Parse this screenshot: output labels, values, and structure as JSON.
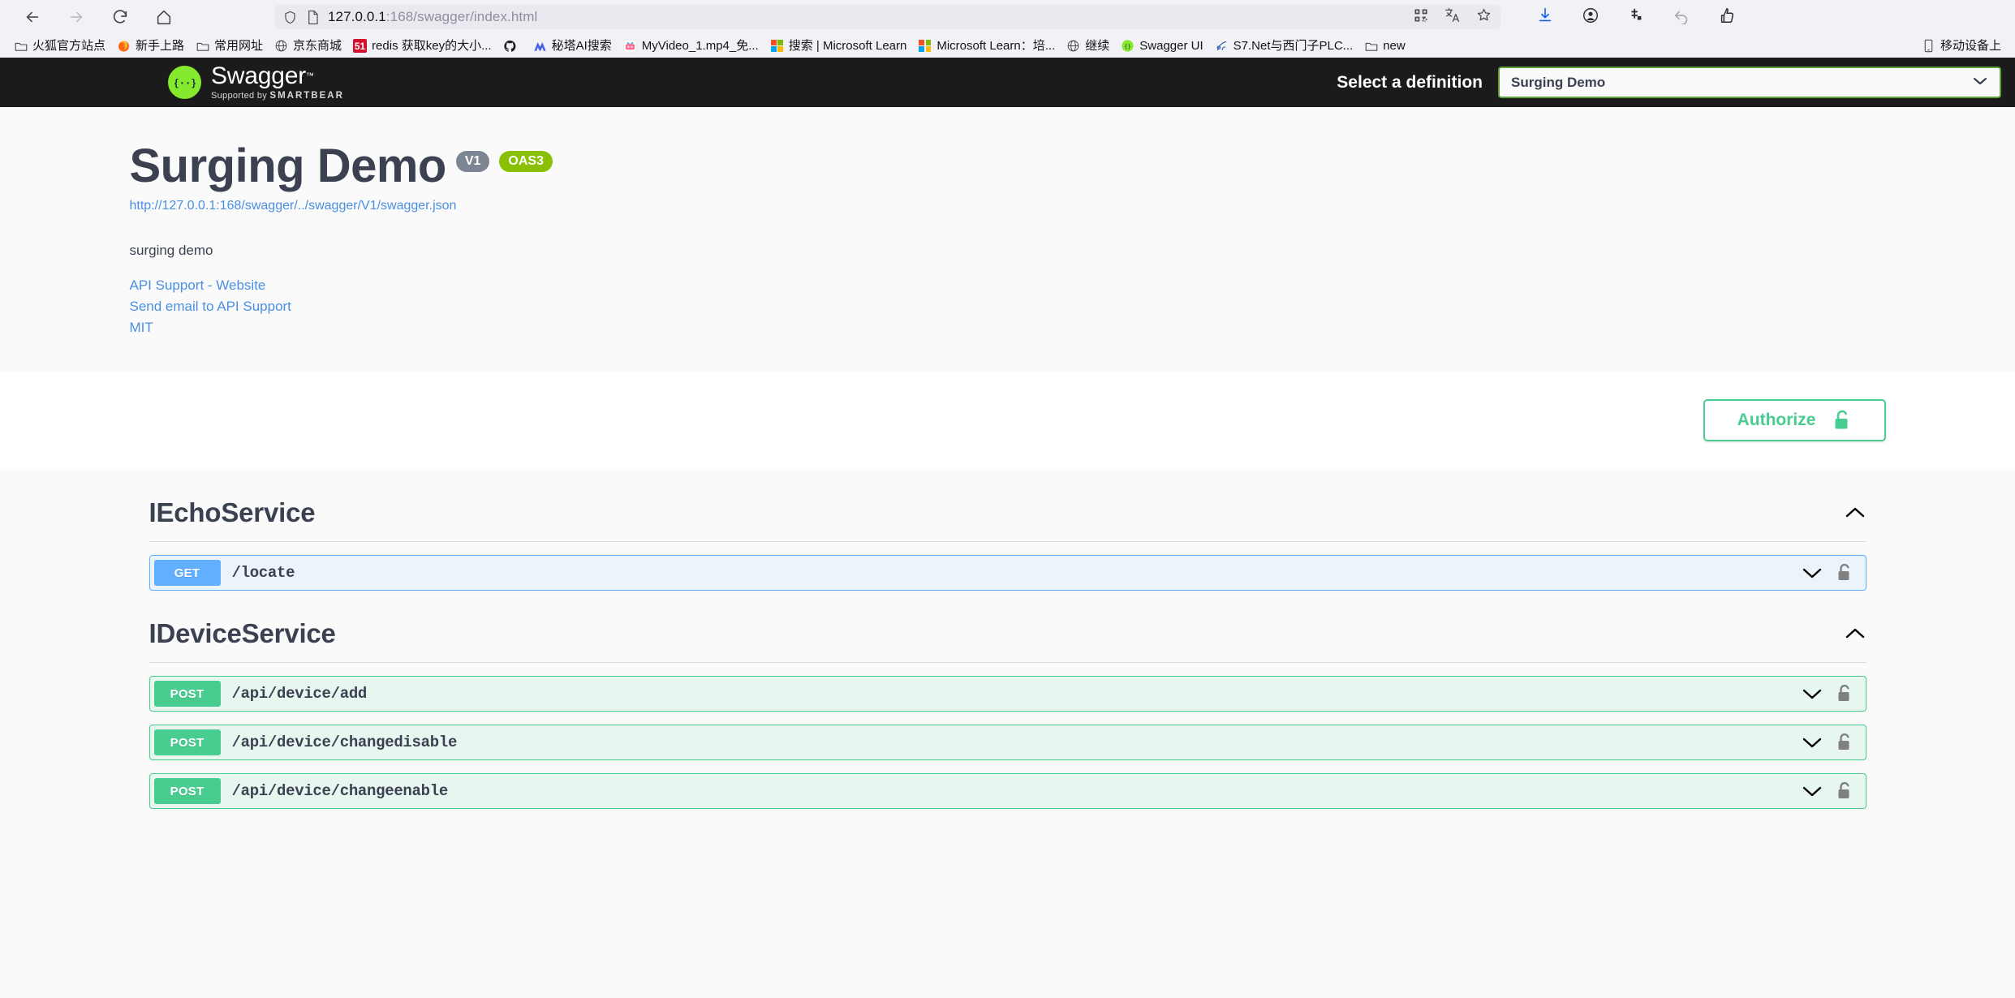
{
  "browser": {
    "nav": [
      {
        "name": "back",
        "icon": "arrow-left-icon",
        "enabled": true
      },
      {
        "name": "forward",
        "icon": "arrow-right-icon",
        "enabled": false
      },
      {
        "name": "reload",
        "icon": "reload-icon",
        "enabled": true
      },
      {
        "name": "home",
        "icon": "home-icon",
        "enabled": true
      }
    ],
    "url": {
      "host": "127.0.0.1",
      "rest": ":168/swagger/index.html",
      "full": "127.0.0.1:168/swagger/index.html",
      "shield_icon": "shield-icon",
      "page_icon": "page-icon"
    },
    "url_actions": [
      "qr-code-icon",
      "translate-icon",
      "bookmark-star-icon"
    ],
    "toolbar_right": [
      "download-icon",
      "account-icon",
      "extensions-icon",
      "undo-icon",
      "save-to-pocket-icon"
    ],
    "bookmarks": [
      {
        "label": "火狐官方站点",
        "icon": "folder-icon"
      },
      {
        "label": "新手上路",
        "icon": "firefox-icon"
      },
      {
        "label": "常用网址",
        "icon": "folder-icon"
      },
      {
        "label": "京东商城",
        "icon": "globe-icon"
      },
      {
        "label": "redis 获取key的大小...",
        "icon": "51cto-icon"
      },
      {
        "label": "",
        "icon": "github-icon"
      },
      {
        "label": "秘塔AI搜索",
        "icon": "metaso-icon"
      },
      {
        "label": "MyVideo_1.mp4_免...",
        "icon": "bilibili-icon"
      },
      {
        "label": "搜索 | Microsoft Learn",
        "icon": "microsoft-icon"
      },
      {
        "label": "Microsoft Learn：培...",
        "icon": "microsoft-icon"
      },
      {
        "label": "继续",
        "icon": "globe-icon"
      },
      {
        "label": "Swagger UI",
        "icon": "swagger-icon"
      },
      {
        "label": "S7.Net与西门子PLC...",
        "icon": "cnblogs-icon"
      },
      {
        "label": "new",
        "icon": "folder-icon"
      }
    ],
    "bookmarks_overflow": {
      "label": "移动设备上",
      "icon": "mobile-icon"
    }
  },
  "topbar": {
    "logo_title": "Swagger",
    "logo_tm": "™",
    "logo_sub_prefix": "Supported by ",
    "logo_sub_brand": "SMARTBEAR",
    "logo_glyph": "{···}",
    "select_label": "Select a definition",
    "selected_definition": "Surging Demo",
    "caret_icon": "chevron-down-icon"
  },
  "info": {
    "title": "Surging Demo",
    "version_badge": "V1",
    "oas_badge": "OAS3",
    "spec_url": "http://127.0.0.1:168/swagger/../swagger/V1/swagger.json",
    "description": "surging demo",
    "links": [
      {
        "label": "API Support - Website"
      },
      {
        "label": "Send email to API Support"
      },
      {
        "label": "MIT"
      }
    ]
  },
  "auth": {
    "authorize_label": "Authorize",
    "lock_icon": "unlocked-padlock-icon"
  },
  "colors": {
    "swagger_green": "#49cc90",
    "get_blue": "#61affe",
    "oas_green": "#89bf04",
    "version_gray": "#7d8492",
    "link_blue": "#4a90e2",
    "topbar_black": "#1b1b1b",
    "select_border": "#62a03f"
  },
  "tags": [
    {
      "name": "IEchoService",
      "collapse_icon": "chevron-up-icon",
      "operations": [
        {
          "method": "GET",
          "method_class": "get",
          "path": "/locate",
          "expand_icon": "chevron-down-icon",
          "lock_icon": "padlock-icon"
        }
      ]
    },
    {
      "name": "IDeviceService",
      "collapse_icon": "chevron-up-icon",
      "operations": [
        {
          "method": "POST",
          "method_class": "post",
          "path": "/api/device/add",
          "expand_icon": "chevron-down-icon",
          "lock_icon": "padlock-icon"
        },
        {
          "method": "POST",
          "method_class": "post",
          "path": "/api/device/changedisable",
          "expand_icon": "chevron-down-icon",
          "lock_icon": "padlock-icon"
        },
        {
          "method": "POST",
          "method_class": "post",
          "path": "/api/device/changeenable",
          "expand_icon": "chevron-down-icon",
          "lock_icon": "padlock-icon"
        }
      ]
    }
  ]
}
